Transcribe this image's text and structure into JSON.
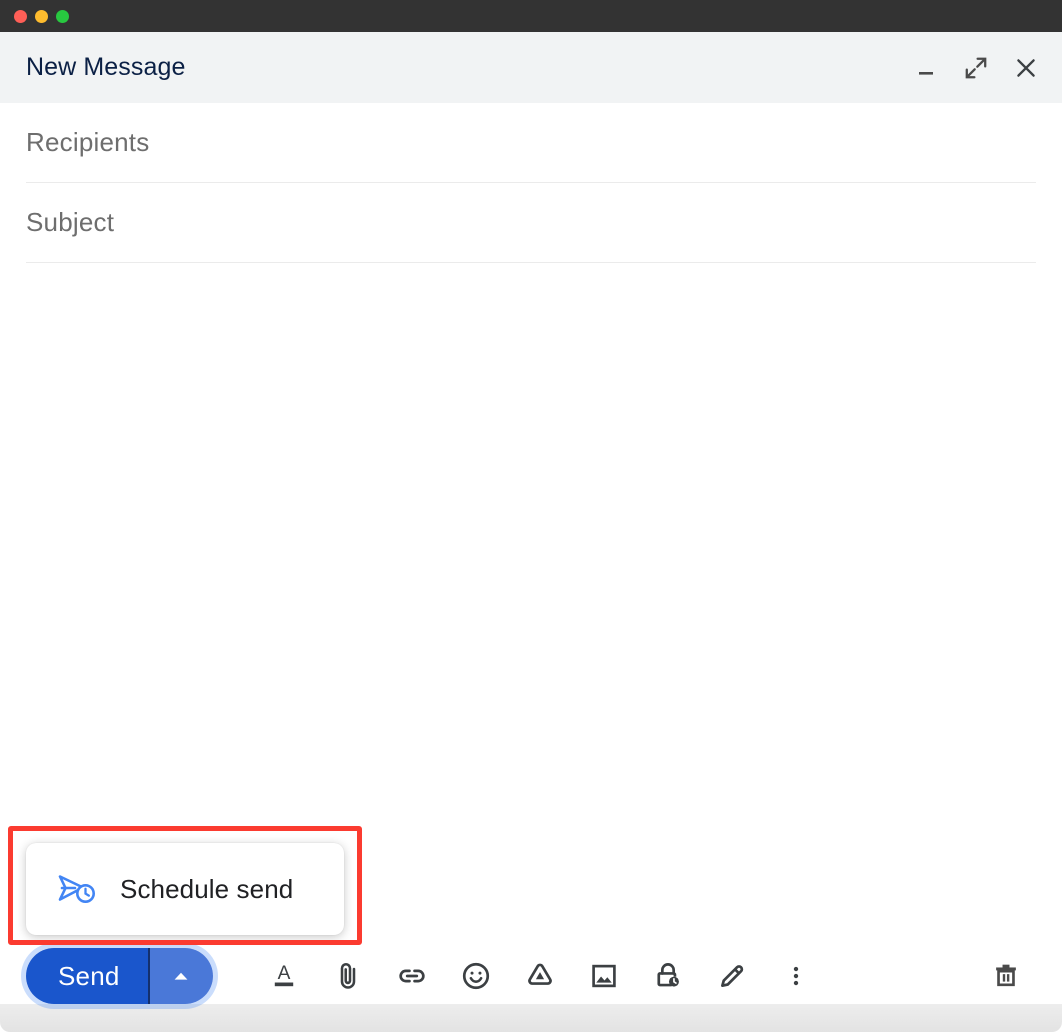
{
  "window": {
    "traffic_lights": [
      {
        "name": "close",
        "color": "#ff5f57"
      },
      {
        "name": "minimize",
        "color": "#febc2e"
      },
      {
        "name": "zoom",
        "color": "#28c840"
      }
    ]
  },
  "header": {
    "title": "New Message",
    "title_color": "#0b2045",
    "background": "#f1f3f4",
    "actions": [
      {
        "name": "minimize-window-button",
        "icon": "minimize-icon",
        "label": "Minimize"
      },
      {
        "name": "expand-window-button",
        "icon": "expand-icon",
        "label": "Full screen"
      },
      {
        "name": "close-window-button",
        "icon": "close-icon",
        "label": "Save & close"
      }
    ]
  },
  "fields": [
    {
      "name": "recipients-field",
      "placeholder": "Recipients",
      "value": ""
    },
    {
      "name": "subject-field",
      "placeholder": "Subject",
      "value": ""
    }
  ],
  "body": {
    "placeholder": "",
    "value": ""
  },
  "send": {
    "label": "Send",
    "caret_icon": "caret-up-icon",
    "main_color": "#1a56cc",
    "caret_color": "#4a78d8",
    "focus_ring": "#4285f4"
  },
  "toolbar": {
    "items": [
      {
        "name": "formatting-options-button",
        "icon": "format-text-icon",
        "label": "Formatting options"
      },
      {
        "name": "attach-file-button",
        "icon": "paperclip-icon",
        "label": "Attach files"
      },
      {
        "name": "insert-link-button",
        "icon": "link-icon",
        "label": "Insert link"
      },
      {
        "name": "insert-emoji-button",
        "icon": "emoji-icon",
        "label": "Insert emoji"
      },
      {
        "name": "insert-drive-file-button",
        "icon": "drive-icon",
        "label": "Insert files using Drive"
      },
      {
        "name": "insert-photo-button",
        "icon": "image-icon",
        "label": "Insert photo"
      },
      {
        "name": "confidential-mode-button",
        "icon": "lock-clock-icon",
        "label": "Toggle confidential mode"
      },
      {
        "name": "insert-signature-button",
        "icon": "pen-icon",
        "label": "Insert signature"
      },
      {
        "name": "more-options-button",
        "icon": "more-vertical-icon",
        "label": "More options"
      }
    ],
    "discard": {
      "name": "discard-draft-button",
      "icon": "trash-icon",
      "label": "Discard draft"
    }
  },
  "popup": {
    "icon": "schedule-send-icon",
    "icon_color": "#4285f4",
    "label": "Schedule send"
  },
  "annotation": {
    "highlight_color": "#fb3b30",
    "target": "schedule-send"
  }
}
